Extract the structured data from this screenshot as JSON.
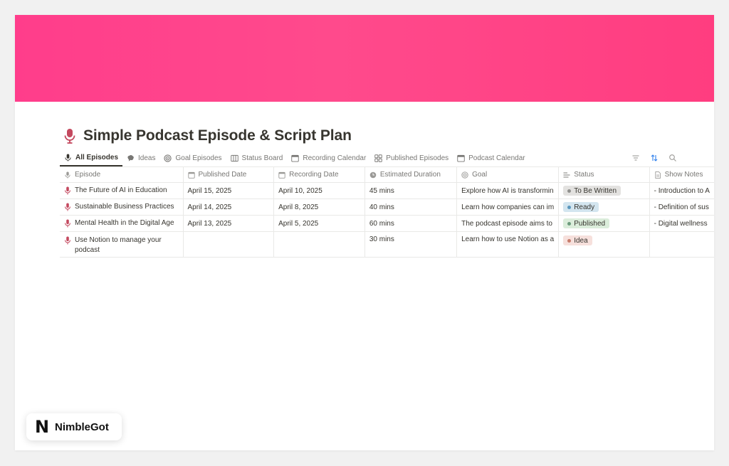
{
  "page": {
    "title": "Simple Podcast Episode & Script Plan",
    "title_icon": "microphone-icon",
    "cover_color": "#ff3d8b"
  },
  "tabs": [
    {
      "label": "All Episodes",
      "icon": "microphone-icon",
      "active": true
    },
    {
      "label": "Ideas",
      "icon": "thought-bubble-icon",
      "active": false
    },
    {
      "label": "Goal Episodes",
      "icon": "target-icon",
      "active": false
    },
    {
      "label": "Status Board",
      "icon": "board-icon",
      "active": false
    },
    {
      "label": "Recording Calendar",
      "icon": "calendar-icon",
      "active": false
    },
    {
      "label": "Published Episodes",
      "icon": "gallery-icon",
      "active": false
    },
    {
      "label": "Podcast Calendar",
      "icon": "calendar-icon",
      "active": false
    }
  ],
  "toolbar": [
    "filter-icon",
    "sort-icon",
    "search-icon"
  ],
  "columns": [
    {
      "label": "Episode",
      "icon": "microphone-icon"
    },
    {
      "label": "Published Date",
      "icon": "calendar-icon"
    },
    {
      "label": "Recording Date",
      "icon": "calendar-icon"
    },
    {
      "label": "Estimated Duration",
      "icon": "clock-icon"
    },
    {
      "label": "Goal",
      "icon": "target-icon"
    },
    {
      "label": "Status",
      "icon": "status-icon"
    },
    {
      "label": "Show Notes",
      "icon": "document-icon"
    }
  ],
  "rows": [
    {
      "episode": "The Future of AI in Education",
      "published": "April 15, 2025",
      "recording": "April 10, 2025",
      "duration": "45 mins",
      "goal": "Explore how AI is transformin",
      "status": "To Be Written",
      "status_color": "#e3e2e0",
      "status_dot": "#91918e",
      "notes": "Introduction to A"
    },
    {
      "episode": "Sustainable Business Practices",
      "published": "April 14, 2025",
      "recording": "April 8, 2025",
      "duration": "40 mins",
      "goal": "Learn how companies can im",
      "status": "Ready",
      "status_color": "#d3e5ef",
      "status_dot": "#5b97bd",
      "notes": "Definition of sus"
    },
    {
      "episode": "Mental Health in the Digital Age",
      "published": "April 13, 2025",
      "recording": "April 5, 2025",
      "duration": "60 mins",
      "goal": "The podcast episode aims to",
      "status": "Published",
      "status_color": "#dbeddb",
      "status_dot": "#6c9b7d",
      "notes": "Digital wellness"
    },
    {
      "episode": "Use Notion to manage your podcast",
      "published": "",
      "recording": "",
      "duration": "30 mins",
      "goal": "Learn how to use Notion as a",
      "status": "Idea",
      "status_color": "#f6e0dc",
      "status_dot": "#c77c6b",
      "notes": ""
    }
  ],
  "brand": {
    "logo_letter": "N",
    "name": "NimbleGot"
  },
  "colors": {
    "accent": "#ff3d8b",
    "mic": "#c4495f",
    "text": "#37352f",
    "muted": "#787774"
  }
}
